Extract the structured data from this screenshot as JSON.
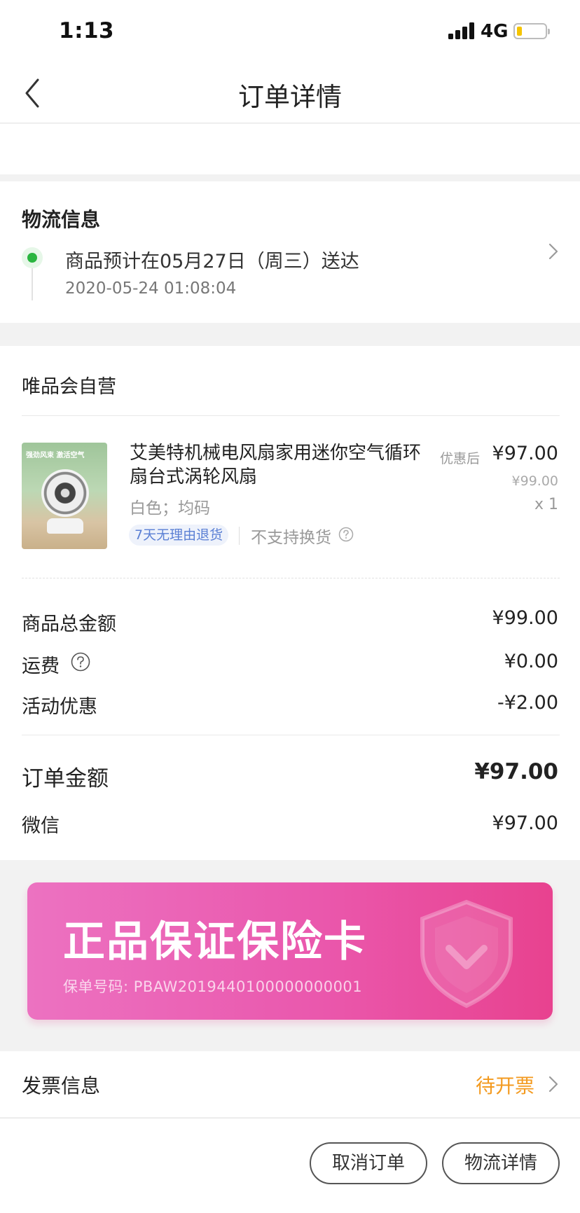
{
  "status_bar": {
    "time": "1:13",
    "network": "4G",
    "battery_level": 0.15,
    "battery_color": "#f5c400"
  },
  "nav": {
    "back_icon": "chevron-left-icon",
    "title": "订单详情"
  },
  "logistics": {
    "title": "物流信息",
    "status_text": "商品预计在05月27日（周三）送达",
    "timestamp": "2020-05-24 01:08:04",
    "dot_color": "#2ab540"
  },
  "order": {
    "store_name": "唯品会自营",
    "product": {
      "name": "艾美特机械电风扇家用迷你空气循环扇台式涡轮风扇",
      "spec": "白色；均码",
      "image_caption": "强劲风束 激活空气",
      "tag_return": "7天无理由退货",
      "tag_no_exchange": "不支持换货",
      "discount_label": "优惠后",
      "price": "¥97.00",
      "original_price": "¥99.00",
      "quantity": "x 1"
    },
    "summary": {
      "goods_total_label": "商品总金额",
      "goods_total_value": "¥99.00",
      "shipping_label": "运费",
      "shipping_value": "¥0.00",
      "promo_label": "活动优惠",
      "promo_value": "-¥2.00"
    },
    "total": {
      "label": "订单金额",
      "value": "¥97.00"
    },
    "payment": {
      "method": "微信",
      "value": "¥97.00"
    }
  },
  "insurance": {
    "title": "正品保证保险卡",
    "policy_no": "保单号码: PBAW2019440100000000001",
    "icon": "shield-icon"
  },
  "invoice": {
    "label": "发票信息",
    "status": "待开票",
    "status_color": "#f39a1f"
  },
  "actions": {
    "cancel_label": "取消订单",
    "logistics_label": "物流详情"
  }
}
